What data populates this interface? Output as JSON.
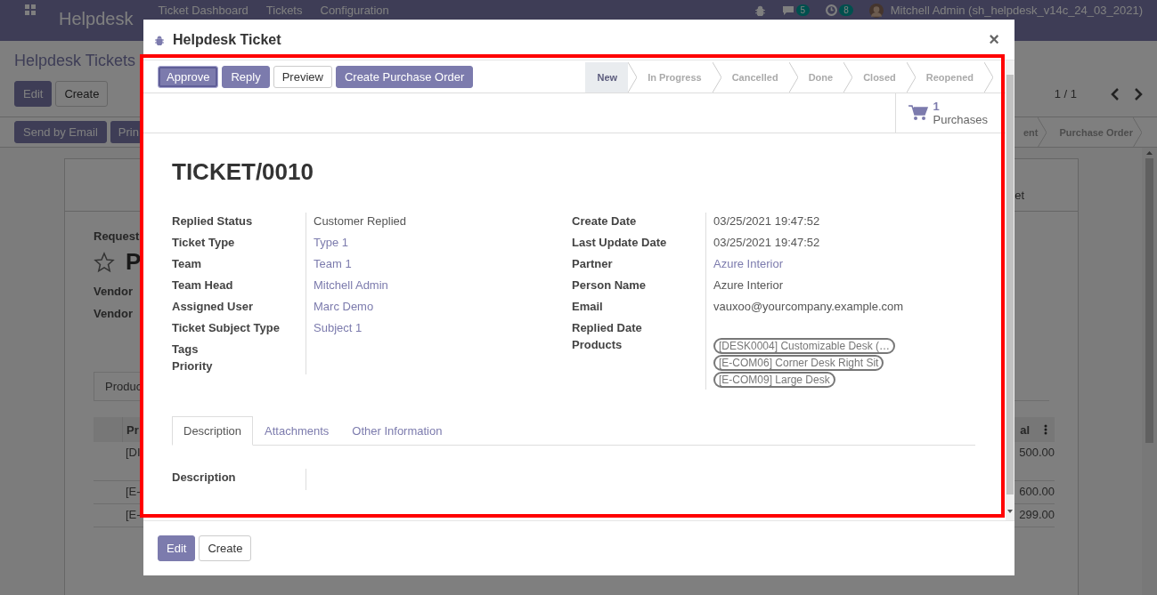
{
  "app_bar": {
    "app_name": "Helpdesk",
    "menus": [
      "Ticket Dashboard",
      "Tickets",
      "Configuration"
    ],
    "chat_count": "5",
    "activity_count": "8",
    "user": "Mitchell Admin (sh_helpdesk_v14c_24_03_2021)"
  },
  "background": {
    "breadcrumb": "Helpdesk Tickets",
    "buttons": [
      "Edit",
      "Create"
    ],
    "pager": "1 / 1",
    "action_buttons": [
      "Send by Email",
      "Prin"
    ],
    "stages": [
      "ent",
      "Purchase Order"
    ],
    "tab_fragment": "et",
    "request_label": "Request",
    "title_fragment": "P",
    "fields": [
      "Vendor",
      "Vendor"
    ],
    "notebook_tab": "Produc",
    "column_fragment": "Pr",
    "total_column": "al",
    "rows": [
      {
        "product": "[DI",
        "total": "500.00"
      },
      {
        "product": "[E-",
        "total": "600.00"
      },
      {
        "product": "[E-",
        "total": "299.00"
      }
    ]
  },
  "dialog": {
    "title": "Helpdesk Ticket",
    "close": "×",
    "buttons": [
      {
        "label": "Approve",
        "kind": "primary",
        "focused": true
      },
      {
        "label": "Reply",
        "kind": "primary",
        "focused": false
      },
      {
        "label": "Preview",
        "kind": "secondary",
        "focused": false
      },
      {
        "label": "Create Purchase Order",
        "kind": "primary",
        "focused": false
      }
    ],
    "stages": [
      {
        "label": "New",
        "selected": true
      },
      {
        "label": "In Progress",
        "selected": false
      },
      {
        "label": "Cancelled",
        "selected": false
      },
      {
        "label": "Done",
        "selected": false
      },
      {
        "label": "Closed",
        "selected": false
      },
      {
        "label": "Reopened",
        "selected": false
      }
    ],
    "stat_button": {
      "count": "1",
      "label": "Purchases"
    },
    "name": "TICKET/0010",
    "left_fields": [
      {
        "label": "Replied Status",
        "value": "Customer Replied",
        "kind": "text"
      },
      {
        "label": "Ticket Type",
        "value": "Type 1",
        "kind": "link"
      },
      {
        "label": "Team",
        "value": "Team 1",
        "kind": "link"
      },
      {
        "label": "Team Head",
        "value": "Mitchell Admin",
        "kind": "link"
      },
      {
        "label": "Assigned User",
        "value": "Marc Demo",
        "kind": "link"
      },
      {
        "label": "Ticket Subject Type",
        "value": "Subject 1",
        "kind": "link"
      },
      {
        "label": "Tags",
        "kind": "empty"
      },
      {
        "label": "Priority",
        "kind": "empty"
      }
    ],
    "right_fields": [
      {
        "label": "Create Date",
        "value": "03/25/2021 19:47:52",
        "kind": "text"
      },
      {
        "label": "Last Update Date",
        "value": "03/25/2021 19:47:52",
        "kind": "text"
      },
      {
        "label": "Partner",
        "value": "Azure Interior",
        "kind": "link"
      },
      {
        "label": "Person Name",
        "value": "Azure Interior",
        "kind": "text"
      },
      {
        "label": "Email",
        "value": "vauxoo@yourcompany.example.com",
        "kind": "text"
      },
      {
        "label": "Replied Date",
        "kind": "empty"
      },
      {
        "label": "Products",
        "kind": "tags",
        "tags": [
          " [DESK0004] Customizable Desk (…",
          "[E-COM06] Corner Desk Right Sit",
          "[E-COM09] Large Desk"
        ]
      }
    ],
    "tabs": [
      {
        "label": "Description",
        "selected": true
      },
      {
        "label": "Attachments",
        "selected": false
      },
      {
        "label": "Other Information",
        "selected": false
      }
    ],
    "description_label": "Description",
    "footer_buttons": [
      {
        "label": "Edit",
        "kind": "primary"
      },
      {
        "label": "Create",
        "kind": "secondary"
      }
    ]
  }
}
